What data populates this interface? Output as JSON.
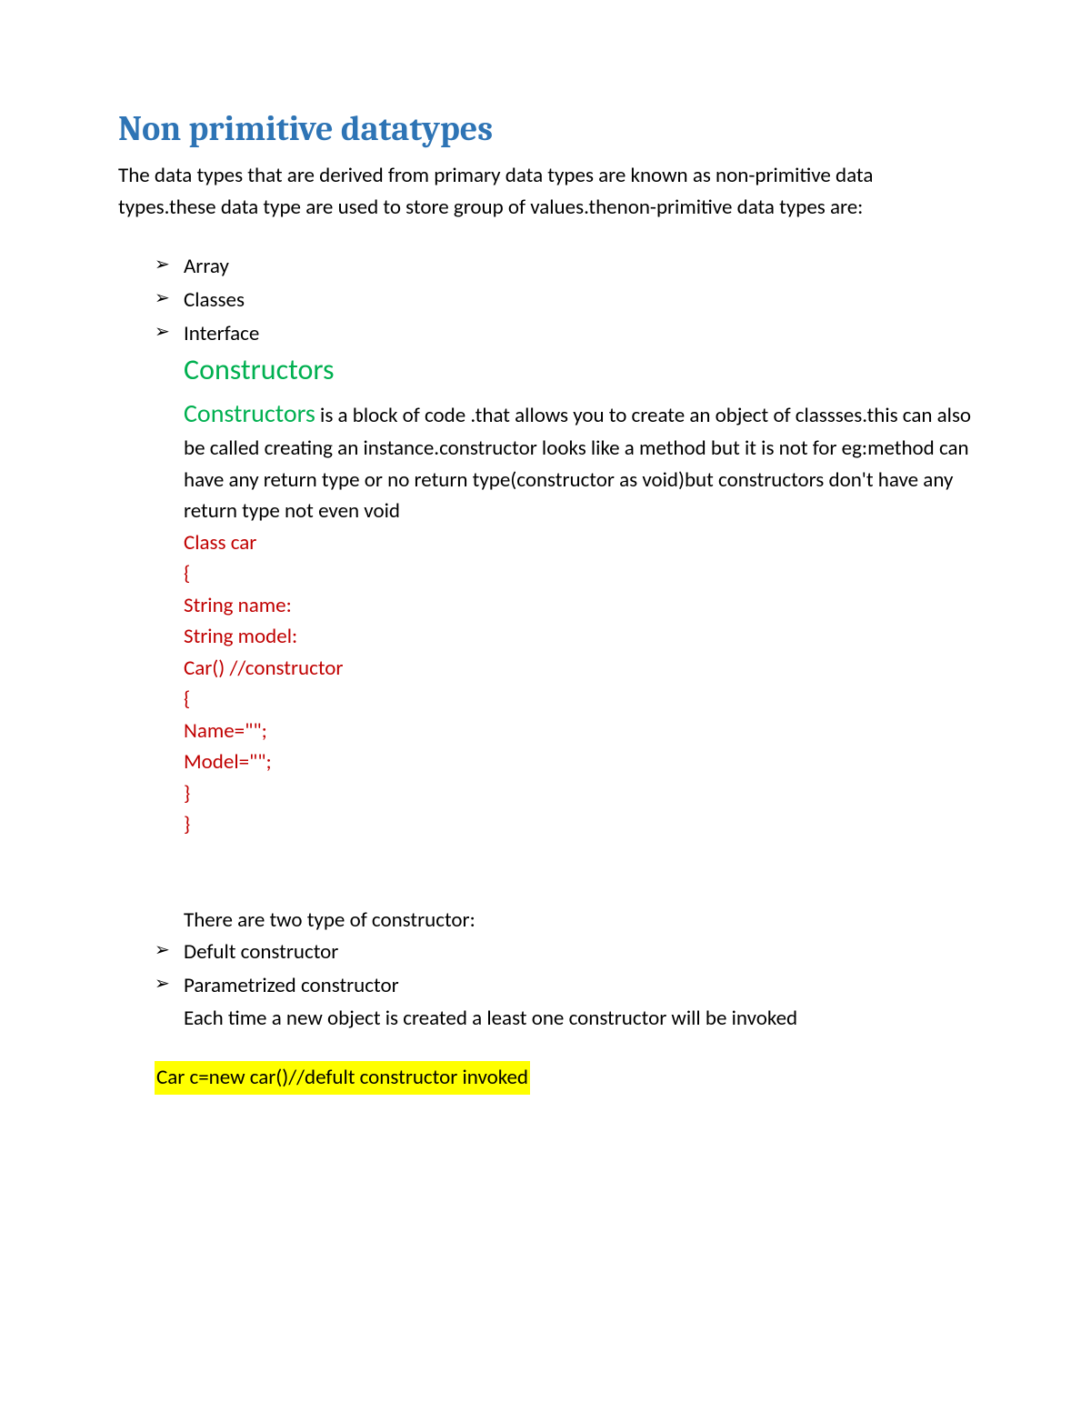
{
  "title": "Non primitive datatypes",
  "intro": "The data types that are derived from primary data types are known as non-primitive data types.these data type are used to store group of  values.thenon-primitive data types are:",
  "bulletsTop": [
    "Array",
    "Classes",
    "Interface"
  ],
  "constructorsHeading": "Constructors",
  "constructorsInline": "Constructors",
  "constructorsBody": " is a block of code .that allows you to create an object of classses.this can also be called creating an instance.constructor looks like a method but it is not for eg:method can have any return type or no return type(constructor as void)but constructors don't have any return type not even void",
  "codeLines": [
    "Class car",
    "{",
    "String name:",
    "String model:",
    "Car() //constructor",
    "{",
    "Name=\"\";",
    "Model=\"\";",
    "}",
    "}"
  ],
  "typesIntro": "There are two type of constructor:",
  "bulletsTypes": [
    "Defult constructor",
    "Parametrized constructor"
  ],
  "invokedText": "Each time a new object is created a least one constructor will be invoked",
  "highlighted": "Car c=new car()//defult constructor invoked"
}
